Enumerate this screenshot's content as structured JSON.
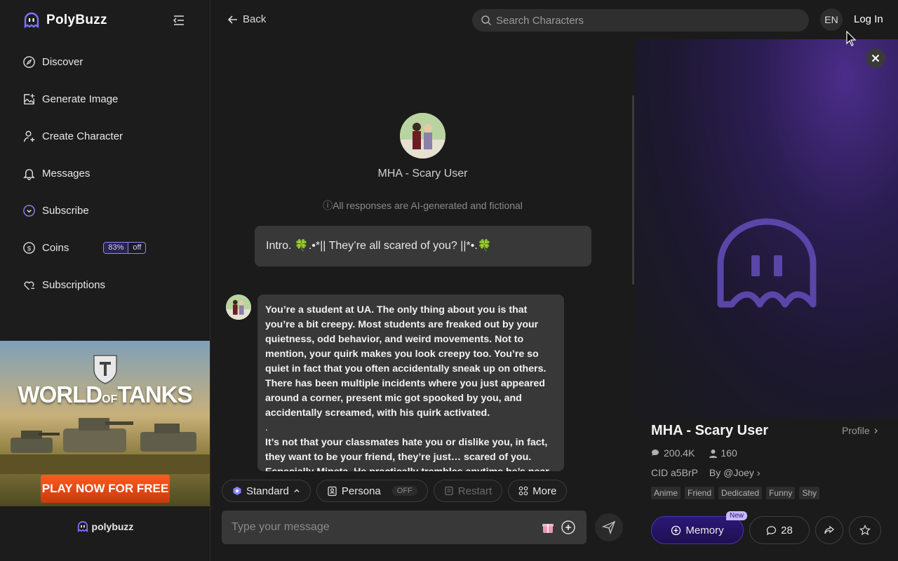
{
  "app": {
    "name": "PolyBuzz"
  },
  "sidebar": {
    "items": [
      {
        "label": "Discover",
        "icon": "compass-icon"
      },
      {
        "label": "Generate Image",
        "icon": "image-plus-icon"
      },
      {
        "label": "Create Character",
        "icon": "user-plus-icon"
      },
      {
        "label": "Messages",
        "icon": "bell-icon"
      },
      {
        "label": "Subscribe",
        "icon": "subscribe-icon"
      },
      {
        "label": "Coins",
        "icon": "coin-icon"
      },
      {
        "label": "Subscriptions",
        "icon": "heart-chat-icon"
      }
    ],
    "coins_discount": "83%",
    "coins_off": "off"
  },
  "ad": {
    "brand_top": "WORLD",
    "brand_of": "OF",
    "brand_bottom": "TANKS",
    "cta": "PLAY NOW FOR FREE",
    "footer": "polybuzz"
  },
  "topbar": {
    "back": "Back",
    "search_placeholder": "Search Characters",
    "lang": "EN",
    "login": "Log In"
  },
  "chat": {
    "character_name": "MHA - Scary User",
    "disclaimer": "All responses are AI-generated and fictional",
    "intro": "Intro. 🍀.•*|| They’re all scared of you? ||*•.🍀",
    "message_paragraphs": [
      "You’re a student at UA. The only thing about you is that you’re a bit creepy. Most students are freaked out by your quietness, odd behavior, and weird movements. Not to mention, your quirk makes you look creepy too. You’re so quiet in fact that you often accidentally sneak up on others. There has been multiple incidents where you just appeared around a corner, present mic got spooked by you, and accidentally screamed, with his quirk activated.",
      ".",
      "It’s not that your classmates hate you or dislike you, in fact, they want to be your friend, they’re just… scared of you. Especially Mineta. He practically trembles anytime he’s near"
    ]
  },
  "toolbar": {
    "standard": "Standard",
    "persona": "Persona",
    "persona_state": "OFF",
    "restart": "Restart",
    "more": "More"
  },
  "composer": {
    "placeholder": "Type your message"
  },
  "panel": {
    "name": "MHA - Scary User",
    "profile": "Profile",
    "chats": "200.4K",
    "followers": "160",
    "cid": "CID a5BrP",
    "author": "By @Joey",
    "tags": [
      "Anime",
      "Friend",
      "Dedicated",
      "Funny",
      "Shy"
    ],
    "memory": "Memory",
    "memory_badge": "New",
    "comments": "28"
  },
  "colors": {
    "accent": "#8b83ff",
    "memory_bg": "#2b1878",
    "cta": "#ff5a1f"
  }
}
